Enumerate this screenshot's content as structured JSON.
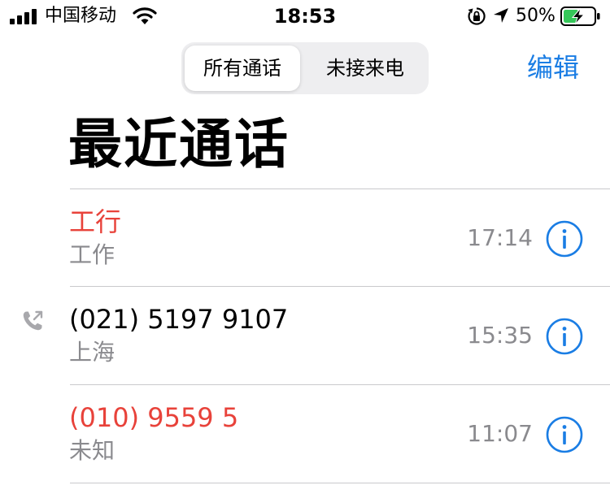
{
  "status_bar": {
    "carrier": "中国移动",
    "time": "18:53",
    "battery_percent": "50%",
    "icons": [
      "signal-icon",
      "wifi-icon",
      "rotation-lock-icon",
      "location-icon",
      "battery-charging-icon"
    ]
  },
  "segmented_control": {
    "options": [
      "所有通话",
      "未接来电"
    ],
    "selected": "所有通话"
  },
  "nav": {
    "edit_label": "编辑"
  },
  "title": "最近通话",
  "calls": [
    {
      "name": "工行",
      "label": "工作",
      "time": "17:14",
      "missed": true,
      "outgoing": false
    },
    {
      "name": "(021) 5197 9107",
      "label": "上海",
      "time": "15:35",
      "missed": false,
      "outgoing": true
    },
    {
      "name": "(010) 9559 5",
      "label": "未知",
      "time": "11:07",
      "missed": true,
      "outgoing": false
    }
  ],
  "colors": {
    "accent": "#1a7de4",
    "missed": "#e8423a",
    "secondary_text": "#8a8a8e",
    "battery_charge": "#35c759"
  }
}
